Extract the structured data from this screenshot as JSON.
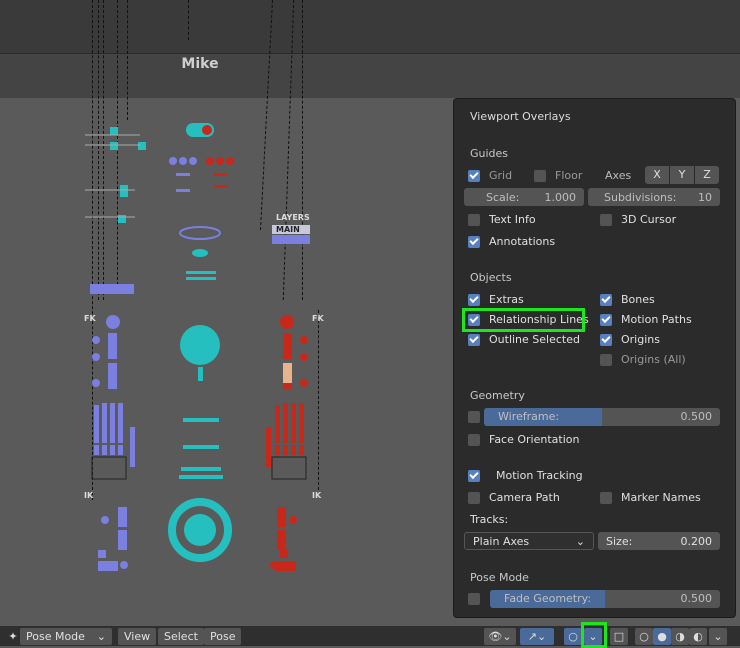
{
  "viewport": {
    "rig_name": "Mike",
    "labels": {
      "fk_left": "FK",
      "fk_right": "FK",
      "ik_left": "IK",
      "ik_right": "IK",
      "layers": "LAYERS",
      "main": "MAIN"
    }
  },
  "overlays": {
    "title": "Viewport Overlays",
    "guides": {
      "heading": "Guides",
      "grid": {
        "label": "Grid",
        "checked": true
      },
      "floor": {
        "label": "Floor",
        "checked": false
      },
      "axes_label": "Axes",
      "axes": [
        "X",
        "Y",
        "Z"
      ],
      "scale": {
        "label": "Scale:",
        "value": "1.000"
      },
      "subdivisions": {
        "label": "Subdivisions:",
        "value": "10"
      },
      "text_info": {
        "label": "Text Info",
        "checked": false
      },
      "cursor_3d": {
        "label": "3D Cursor",
        "checked": false
      },
      "annotations": {
        "label": "Annotations",
        "checked": true
      }
    },
    "objects": {
      "heading": "Objects",
      "extras": {
        "label": "Extras",
        "checked": true
      },
      "bones": {
        "label": "Bones",
        "checked": true
      },
      "relationship_lines": {
        "label": "Relationship Lines",
        "checked": true
      },
      "motion_paths": {
        "label": "Motion Paths",
        "checked": true
      },
      "outline_selected": {
        "label": "Outline Selected",
        "checked": true
      },
      "origins": {
        "label": "Origins",
        "checked": true
      },
      "origins_all": {
        "label": "Origins (All)",
        "checked": false
      }
    },
    "geometry": {
      "heading": "Geometry",
      "wireframe": {
        "label": "Wireframe:",
        "value": "0.500",
        "fraction": 0.5,
        "checked": false
      },
      "face_orientation": {
        "label": "Face Orientation",
        "checked": false
      }
    },
    "motion_tracking": {
      "label": "Motion Tracking",
      "checked": true,
      "camera_path": {
        "label": "Camera Path",
        "checked": false
      },
      "marker_names": {
        "label": "Marker Names",
        "checked": false
      },
      "tracks_label": "Tracks:",
      "tracks_value": "Plain Axes",
      "size": {
        "label": "Size:",
        "value": "0.200"
      }
    },
    "pose_mode": {
      "heading": "Pose Mode",
      "fade_geometry": {
        "label": "Fade Geometry:",
        "value": "0.500",
        "fraction": 0.5,
        "checked": false
      }
    }
  },
  "bottom_bar": {
    "mode": "Pose Mode",
    "menu": [
      "View",
      "Select",
      "Pose"
    ]
  },
  "colors": {
    "accent": "#5680c2",
    "highlight": "#1fe51f",
    "widget_blue": "#7b7fe0",
    "widget_red": "#c8281a",
    "widget_teal": "#26bfbf"
  }
}
